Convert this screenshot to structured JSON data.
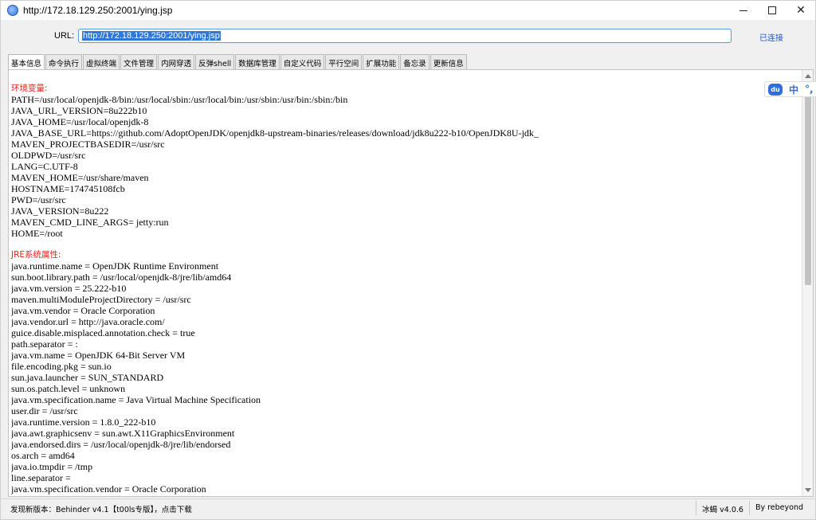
{
  "window": {
    "title": "http://172.18.129.250:2001/ying.jsp",
    "controls": {
      "minimize": "minimize",
      "maximize": "maximize",
      "close": "✕"
    }
  },
  "url_bar": {
    "label": "URL:",
    "value": "http://172.18.129.250:2001/ying.jsp",
    "status": "已连接"
  },
  "tabs": [
    {
      "label": "基本信息",
      "active": true
    },
    {
      "label": "命令执行"
    },
    {
      "label": "虚拟终端"
    },
    {
      "label": "文件管理"
    },
    {
      "label": "内网穿透"
    },
    {
      "label": "反弹shell"
    },
    {
      "label": "数据库管理"
    },
    {
      "label": "自定义代码"
    },
    {
      "label": "平行空间"
    },
    {
      "label": "扩展功能"
    },
    {
      "label": "备忘录"
    },
    {
      "label": "更新信息"
    }
  ],
  "env_section": {
    "title": "环境变量:",
    "lines": [
      "PATH=/usr/local/openjdk-8/bin:/usr/local/sbin:/usr/local/bin:/usr/sbin:/usr/bin:/sbin:/bin",
      "JAVA_URL_VERSION=8u222b10",
      "JAVA_HOME=/usr/local/openjdk-8",
      "JAVA_BASE_URL=https://github.com/AdoptOpenJDK/openjdk8-upstream-binaries/releases/download/jdk8u222-b10/OpenJDK8U-jdk_",
      "MAVEN_PROJECTBASEDIR=/usr/src",
      "OLDPWD=/usr/src",
      "LANG=C.UTF-8",
      "MAVEN_HOME=/usr/share/maven",
      "HOSTNAME=174745108fcb",
      "PWD=/usr/src",
      "JAVA_VERSION=8u222",
      "MAVEN_CMD_LINE_ARGS= jetty:run",
      "HOME=/root"
    ]
  },
  "jre_section": {
    "title": "JRE系统属性:",
    "lines": [
      "java.runtime.name = OpenJDK Runtime Environment",
      "sun.boot.library.path = /usr/local/openjdk-8/jre/lib/amd64",
      "java.vm.version = 25.222-b10",
      "maven.multiModuleProjectDirectory = /usr/src",
      "java.vm.vendor = Oracle Corporation",
      "java.vendor.url = http://java.oracle.com/",
      "guice.disable.misplaced.annotation.check = true",
      "path.separator = :",
      "java.vm.name = OpenJDK 64-Bit Server VM",
      "file.encoding.pkg = sun.io",
      "sun.java.launcher = SUN_STANDARD",
      "sun.os.patch.level = unknown",
      "java.vm.specification.name = Java Virtual Machine Specification",
      "user.dir = /usr/src",
      "java.runtime.version = 1.8.0_222-b10",
      "java.awt.graphicsenv = sun.awt.X11GraphicsEnvironment",
      "java.endorsed.dirs = /usr/local/openjdk-8/jre/lib/endorsed",
      "os.arch = amd64",
      "java.io.tmpdir = /tmp",
      "line.separator = ",
      "java.vm.specification.vendor = Oracle Corporation"
    ]
  },
  "ime": {
    "du": "du",
    "zh": "中",
    "punct": "°,"
  },
  "statusbar": {
    "message": "发现新版本：Behinder v4.1【t00ls专版】，点击下载",
    "version": "冰蝎 v4.0.6",
    "author": "By rebeyond"
  },
  "icons": {
    "app": "globe-icon",
    "scroll_up": "arrow-up-icon",
    "scroll_down": "arrow-down-icon"
  },
  "colors": {
    "section_title": "#e8231b",
    "link": "#1f52c7",
    "selection": "#3178d6",
    "input_border": "#5a9ae0",
    "ime_blue": "#2f6ee0"
  }
}
